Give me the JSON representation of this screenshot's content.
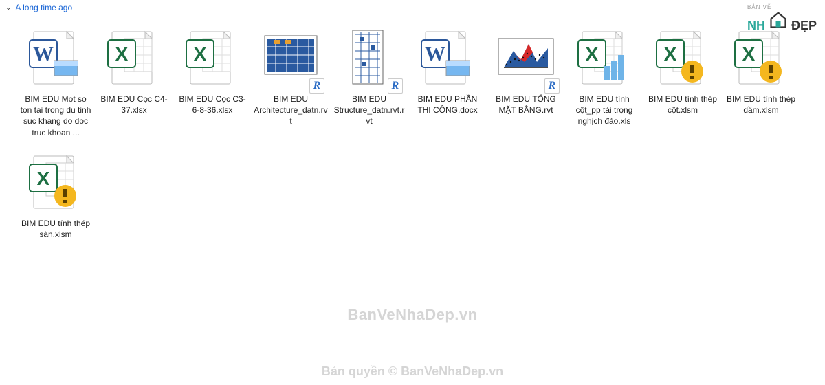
{
  "group": {
    "label": "A long time ago"
  },
  "files": [
    {
      "name": "BIM EDU Mot so ton tai trong du tinh suc khang do doc truc khoan ...",
      "icon": "word"
    },
    {
      "name": "BIM EDU Cọc C4-37.xlsx",
      "icon": "excel"
    },
    {
      "name": "BIM EDU Cọc C3-6-8-36.xlsx",
      "icon": "excel"
    },
    {
      "name": "BIM EDU Architecture_datn.rvt",
      "icon": "revit-arch"
    },
    {
      "name": "BIM EDU Structure_datn.rvt.rvt",
      "icon": "revit-struct"
    },
    {
      "name": "BIM EDU PHẦN THI CÔNG.docx",
      "icon": "word"
    },
    {
      "name": "BIM EDU TỔNG MẶT BẰNG.rvt",
      "icon": "revit-plan"
    },
    {
      "name": "BIM EDU tính cột_pp tải trọng nghịch đảo.xls",
      "icon": "excel-bars"
    },
    {
      "name": "BIM EDU tính thép cột.xlsm",
      "icon": "excel-warn"
    },
    {
      "name": "BIM EDU tính thép dầm.xlsm",
      "icon": "excel-warn"
    },
    {
      "name": "BIM EDU tính thép sàn.xlsm",
      "icon": "excel-warn"
    }
  ],
  "watermark1": "BanVeNhaDep.vn",
  "watermark2": "Bản quyền © BanVeNhaDep.vn",
  "logo": {
    "small": "BẢN VẼ",
    "big1": "NH",
    "big2": "ĐẸP"
  }
}
